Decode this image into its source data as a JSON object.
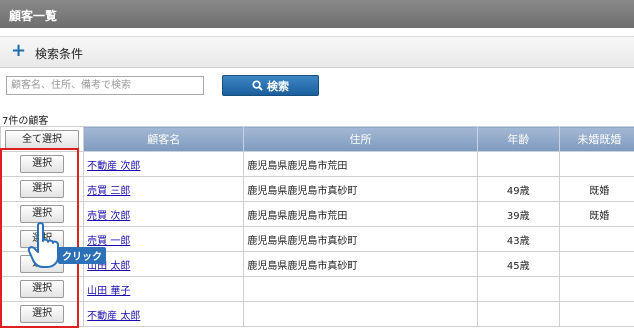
{
  "header": {
    "title": "顧客一覧"
  },
  "search_conditions": {
    "label": "検索条件"
  },
  "search": {
    "placeholder": "顧客名、住所、備考で検索",
    "button_label": "検索"
  },
  "results": {
    "count_text": "7件の顧客"
  },
  "table": {
    "select_all_label": "全て選択",
    "columns": [
      "顧客名",
      "住所",
      "年齢",
      "未婚既婚"
    ],
    "select_label": "選択",
    "rows": [
      {
        "name": "不動産 次郎",
        "address": "鹿児島県鹿児島市荒田",
        "age": "",
        "marital": ""
      },
      {
        "name": "売買 三郎",
        "address": "鹿児島県鹿児島市真砂町",
        "age": "49歳",
        "marital": "既婚"
      },
      {
        "name": "売買 次郎",
        "address": "鹿児島県鹿児島市荒田",
        "age": "39歳",
        "marital": "既婚"
      },
      {
        "name": "売買 一郎",
        "address": "鹿児島県鹿児島市真砂町",
        "age": "43歳",
        "marital": ""
      },
      {
        "name": "山田 太郎",
        "address": "鹿児島県鹿児島市真砂町",
        "age": "45歳",
        "marital": ""
      },
      {
        "name": "山田 華子",
        "address": "",
        "age": "",
        "marital": ""
      },
      {
        "name": "不動産 太郎",
        "address": "",
        "age": "",
        "marital": ""
      }
    ]
  },
  "overlay": {
    "click_label": "クリック",
    "highlight_color": "#e02020"
  }
}
